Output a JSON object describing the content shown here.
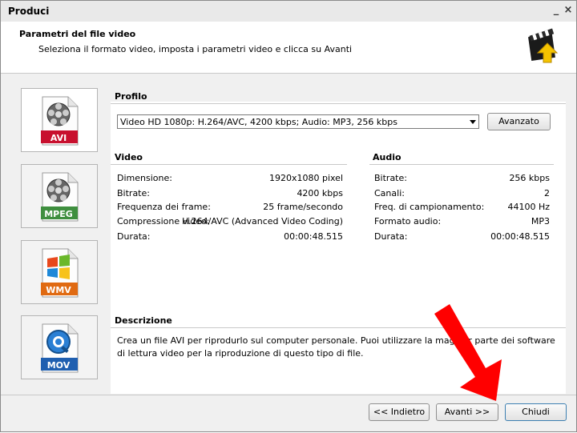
{
  "window": {
    "title": "Produci"
  },
  "header": {
    "title": "Parametri del file video",
    "subtitle": "Seleziona il formato video, imposta i parametri video e clicca su Avanti"
  },
  "formats": [
    {
      "label": "AVI",
      "color": "#c8102e",
      "icon": "film-reel-icon"
    },
    {
      "label": "MPEG",
      "color": "#3f8f3f",
      "icon": "film-reel-icon"
    },
    {
      "label": "WMV",
      "color": "#e06a12",
      "icon": "windows-logo-icon"
    },
    {
      "label": "MOV",
      "color": "#1f5fb0",
      "icon": "quicktime-logo-icon"
    }
  ],
  "profile": {
    "title": "Profilo",
    "selected": "Video HD 1080p: H.264/AVC, 4200 kbps; Audio: MP3, 256 kbps",
    "advanced_label": "Avanzato"
  },
  "video": {
    "title": "Video",
    "rows": [
      {
        "label": "Dimensione:",
        "value": "1920x1080 pixel"
      },
      {
        "label": "Bitrate:",
        "value": "4200 kbps"
      },
      {
        "label": "Frequenza dei frame:",
        "value": "25 frame/secondo"
      },
      {
        "label": "Compressione video:",
        "value": "H.264/AVC (Advanced Video Coding)"
      },
      {
        "label": "Durata:",
        "value": "00:00:48.515"
      }
    ]
  },
  "audio": {
    "title": "Audio",
    "rows": [
      {
        "label": "Bitrate:",
        "value": "256 kbps"
      },
      {
        "label": "Canali:",
        "value": "2"
      },
      {
        "label": "Freq. di campionamento:",
        "value": "44100 Hz"
      },
      {
        "label": "Formato audio:",
        "value": "MP3"
      },
      {
        "label": "Durata:",
        "value": "00:00:48.515"
      }
    ]
  },
  "description": {
    "title": "Descrizione",
    "text": "Crea un file AVI per riprodurlo sul computer personale. Puoi utilizzare la maggior parte dei software di lettura video per la riproduzione di questo tipo di file."
  },
  "buttons": {
    "back": "<< Indietro",
    "next": "Avanti >>",
    "close": "Chiudi"
  },
  "colors": {
    "arrow": "#ff0000",
    "accent": "#f5c400"
  }
}
